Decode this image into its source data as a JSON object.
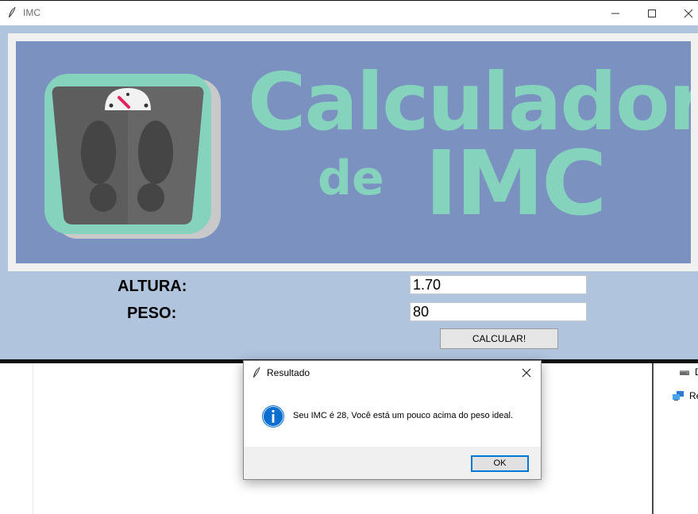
{
  "window": {
    "title": "IMC"
  },
  "banner": {
    "title_line1": "Calculadora",
    "title_de": "de",
    "title_imc": "IMC",
    "accent_color": "#85d3bd",
    "background_color": "#7b92c1"
  },
  "form": {
    "altura_label": "ALTURA:",
    "peso_label": "PESO:",
    "altura_value": "1.70",
    "peso_value": "80",
    "calculate_label": "CALCULAR!"
  },
  "dialog": {
    "title": "Resultado",
    "message": "Seu IMC é 28, Você está um pouco acima do peso ideal.",
    "ok_label": "OK"
  },
  "background_app": {
    "items": [
      {
        "label": "D",
        "icon": "drive-icon"
      },
      {
        "label": "Re",
        "icon": "network-icon"
      }
    ]
  }
}
